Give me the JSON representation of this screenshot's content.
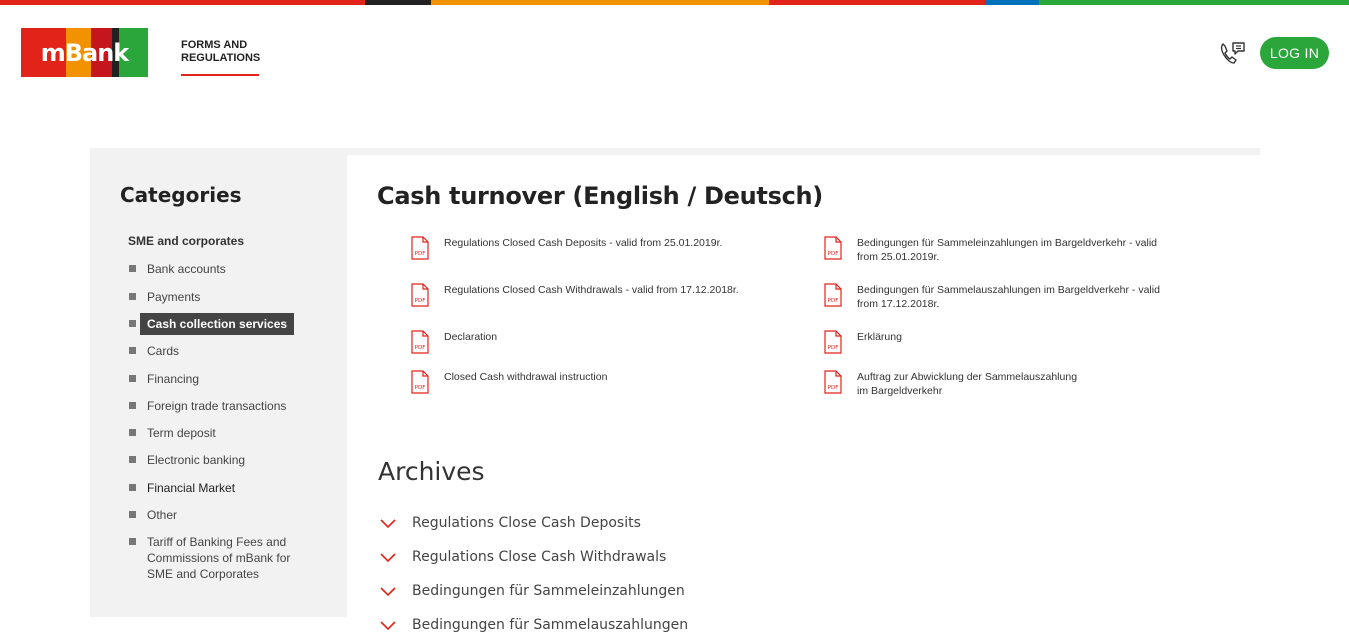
{
  "colors": {
    "brand_red": "#e2231a",
    "brand_orange": "#f39200",
    "brand_green": "#2aa63a",
    "brand_black": "#222222",
    "brand_blue": "#0072bc",
    "sidebar_bg": "#f2f2f2"
  },
  "header": {
    "logo_text": "mBank",
    "nav_forms_line1": "FORMS AND",
    "nav_forms_line2": "REGULATIONS",
    "phone_icon": "phone-chat-icon",
    "login_label": "LOG IN"
  },
  "sidebar": {
    "title": "Categories",
    "section": "SME and corporates",
    "items": [
      {
        "label": "Bank accounts"
      },
      {
        "label": "Payments"
      },
      {
        "label": "Cash collection services",
        "active": true
      },
      {
        "label": "Cards"
      },
      {
        "label": "Financing"
      },
      {
        "label": "Foreign trade transactions"
      },
      {
        "label": "Term deposit"
      },
      {
        "label": "Electronic banking"
      },
      {
        "label": "Financial Market"
      },
      {
        "label": "Other"
      },
      {
        "label_lines": [
          "Tariff of Banking Fees and",
          "Commissions of mBank for",
          "SME and Corporates"
        ]
      }
    ]
  },
  "main": {
    "title": "Cash turnover (English / Deutsch)",
    "pdf_icon_text": "PDF",
    "documents_left": [
      {
        "lines": [
          "Regulations Closed Cash Deposits - valid from 25.01.2019r."
        ]
      },
      {
        "lines": [
          "Regulations Closed Cash Withdrawals - valid from 17.12.2018r."
        ]
      },
      {
        "lines": [
          "Declaration"
        ]
      },
      {
        "lines": [
          "Closed Cash withdrawal instruction"
        ]
      }
    ],
    "documents_right": [
      {
        "lines": [
          "Bedingungen für Sammeleinzahlungen im Bargeldverkehr - valid",
          "from 25.01.2019r."
        ]
      },
      {
        "lines": [
          "Bedingungen für Sammelauszahlungen im Bargeldverkehr - valid",
          "from 17.12.2018r."
        ]
      },
      {
        "lines": [
          "Erklärung"
        ]
      },
      {
        "lines": [
          "Auftrag zur Abwicklung der Sammelauszahlung",
          "im Bargeldverkehr"
        ]
      }
    ],
    "archives_title": "Archives",
    "archives": [
      {
        "label": "Regulations Close Cash Deposits"
      },
      {
        "label": "Regulations Close Cash Withdrawals"
      },
      {
        "label": "Bedingungen für Sammeleinzahlungen"
      },
      {
        "label": "Bedingungen für Sammelauszahlungen"
      }
    ]
  }
}
